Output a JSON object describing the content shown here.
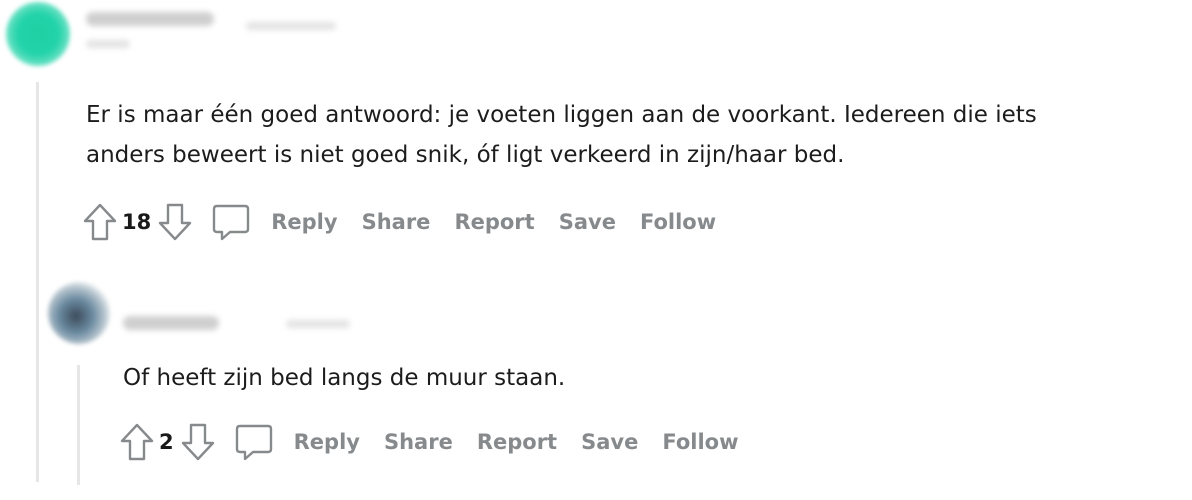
{
  "comments": [
    {
      "avatar_color": "#22d3a9",
      "body_lines": [
        "Er is maar één goed antwoord: je voeten liggen aan de voorkant. Iedereen die iets",
        "anders beweert is niet goed snik, óf ligt verkeerd in zijn/haar bed."
      ],
      "score": "18",
      "actions": [
        "Reply",
        "Share",
        "Report",
        "Save",
        "Follow"
      ],
      "upvote_icon": "arrow-up-icon",
      "downvote_icon": "arrow-down-icon",
      "comment_icon": "speech-bubble-icon"
    },
    {
      "avatar_color": "#6a8aa0",
      "body_lines": [
        "Of heeft zijn bed langs de muur staan."
      ],
      "score": "2",
      "actions": [
        "Reply",
        "Share",
        "Report",
        "Save",
        "Follow"
      ],
      "upvote_icon": "arrow-up-icon",
      "downvote_icon": "arrow-down-icon",
      "comment_icon": "speech-bubble-icon"
    }
  ],
  "colors": {
    "text": "#1c1c1c",
    "action": "#878a8c",
    "thread_line": "#e6e6e6"
  }
}
